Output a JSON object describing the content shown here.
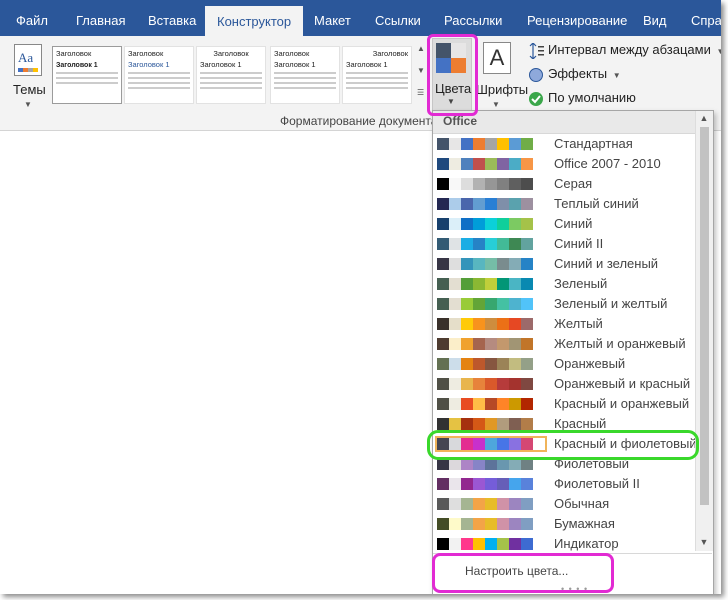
{
  "tabs": [
    {
      "label": "Файл"
    },
    {
      "label": "Главная"
    },
    {
      "label": "Вставка"
    },
    {
      "label": "Конструктор"
    },
    {
      "label": "Макет"
    },
    {
      "label": "Ссылки"
    },
    {
      "label": "Рассылки"
    },
    {
      "label": "Рецензирование"
    },
    {
      "label": "Вид"
    },
    {
      "label": "Справ"
    }
  ],
  "active_tab": "Конструктор",
  "ribbon": {
    "themes_label": "Темы",
    "themes_icon_text": "Aa",
    "gallery": [
      {
        "heading": "Заголовок",
        "title": "Заголовок 1"
      },
      {
        "heading": "Заголовок",
        "title": "Заголовок 1"
      },
      {
        "heading": "Заголовок",
        "title": "Заголовок 1"
      },
      {
        "heading": "Заголовок",
        "title": "Заголовок 1"
      },
      {
        "heading": "Заголовок",
        "title": "Заголовок 1"
      }
    ],
    "colors_label": "Цвета",
    "fonts_label": "Шрифты",
    "fonts_icon_text": "A",
    "paragraph_spacing_label": "Интервал между абзацами",
    "effects_label": "Эффекты",
    "set_default_label": "По умолчанию",
    "group_label": "Форматирование документа"
  },
  "dropdown": {
    "header": "Office",
    "selected": "Красный и фиолетовый",
    "customize_label": "Настроить цвета...",
    "schemes": [
      {
        "name": "Стандартная",
        "colors": [
          "#44546a",
          "#e7e6e6",
          "#4472c4",
          "#ed7d31",
          "#a5a5a5",
          "#ffc000",
          "#5b9bd5",
          "#70ad47"
        ]
      },
      {
        "name": "Office 2007 - 2010",
        "colors": [
          "#1f497d",
          "#eeece1",
          "#4f81bd",
          "#c0504d",
          "#9bbb59",
          "#8064a2",
          "#4bacc6",
          "#f79646"
        ]
      },
      {
        "name": "Серая",
        "colors": [
          "#000000",
          "#f8f8f8",
          "#dddddd",
          "#b2b2b2",
          "#969696",
          "#808080",
          "#5f5f5f",
          "#4d4d4d"
        ]
      },
      {
        "name": "Теплый синий",
        "colors": [
          "#242852",
          "#acccea",
          "#4a66ac",
          "#629dd1",
          "#297fd5",
          "#7f8fa9",
          "#5aa2ae",
          "#9d90a0"
        ]
      },
      {
        "name": "Синий",
        "colors": [
          "#17406d",
          "#dbeff9",
          "#0f6fc6",
          "#009dd9",
          "#0bd0d9",
          "#10cf9b",
          "#7cca62",
          "#a5c249"
        ]
      },
      {
        "name": "Синий II",
        "colors": [
          "#335b74",
          "#dfe3e5",
          "#1cade4",
          "#2683c6",
          "#27ced7",
          "#42ba97",
          "#3e8853",
          "#62a39f"
        ]
      },
      {
        "name": "Синий и зеленый",
        "colors": [
          "#373545",
          "#dedede",
          "#3494ba",
          "#58b6c0",
          "#75bda7",
          "#7a8c8e",
          "#84acb6",
          "#2683c6"
        ]
      },
      {
        "name": "Зеленый",
        "colors": [
          "#455f51",
          "#e3ded1",
          "#549e39",
          "#8ab833",
          "#c0cf3a",
          "#029676",
          "#4ab5c4",
          "#0989b1"
        ]
      },
      {
        "name": "Зеленый и желтый",
        "colors": [
          "#455f51",
          "#e3ded1",
          "#99cb38",
          "#63a537",
          "#37a76f",
          "#44c1a3",
          "#4eb3cf",
          "#51c3f9"
        ]
      },
      {
        "name": "Желтый",
        "colors": [
          "#39302a",
          "#e5dec9",
          "#ffca08",
          "#f8931d",
          "#ce8d3e",
          "#ec7016",
          "#e64823",
          "#9c6a6a"
        ]
      },
      {
        "name": "Желтый и оранжевый",
        "colors": [
          "#4e3b30",
          "#fbeec9",
          "#f0a22e",
          "#a5644e",
          "#b58b80",
          "#c3986d",
          "#a19574",
          "#c17529"
        ]
      },
      {
        "name": "Оранжевый",
        "colors": [
          "#637052",
          "#ccddea",
          "#e48312",
          "#bd582c",
          "#865640",
          "#9b8357",
          "#c2bc80",
          "#94a088"
        ]
      },
      {
        "name": "Оранжевый и красный",
        "colors": [
          "#505046",
          "#eeece1",
          "#e8b54d",
          "#e7833b",
          "#d9592b",
          "#b63b3b",
          "#a4332e",
          "#7f4841"
        ]
      },
      {
        "name": "Красный и оранжевый",
        "colors": [
          "#505046",
          "#eeece1",
          "#e84c22",
          "#ffbd47",
          "#b64926",
          "#ff8427",
          "#cc9900",
          "#b22600"
        ]
      },
      {
        "name": "Красный",
        "colors": [
          "#323232",
          "#e5c243",
          "#a5300f",
          "#d55816",
          "#e19825",
          "#b19c7d",
          "#7f5f52",
          "#b27d49"
        ]
      },
      {
        "name": "Красный и фиолетовый",
        "colors": [
          "#454551",
          "#d8d9dc",
          "#e32d91",
          "#c830cc",
          "#4ea6dc",
          "#4775e7",
          "#8971e1",
          "#d54773"
        ]
      },
      {
        "name": "Фиолетовый",
        "colors": [
          "#373545",
          "#dcd8dc",
          "#ad84c6",
          "#8784c7",
          "#5d739a",
          "#6997af",
          "#84acb6",
          "#6f8183"
        ]
      },
      {
        "name": "Фиолетовый II",
        "colors": [
          "#632e62",
          "#eae5eb",
          "#92278f",
          "#9b57d3",
          "#755dd9",
          "#665eb8",
          "#45a5ed",
          "#5982db"
        ]
      },
      {
        "name": "Обычная",
        "colors": [
          "#595959",
          "#dedede",
          "#a5b592",
          "#f3a447",
          "#e7bc29",
          "#d092a7",
          "#9c85c0",
          "#809ec2"
        ]
      },
      {
        "name": "Бумажная",
        "colors": [
          "#444d26",
          "#fefac9",
          "#a5b592",
          "#f3a447",
          "#e7bc29",
          "#d092a7",
          "#9c85c0",
          "#809ec2"
        ]
      },
      {
        "name": "Индикатор",
        "colors": [
          "#000000",
          "#f2f2f2",
          "#ff388c",
          "#ffc000",
          "#00b0f0",
          "#a5c249",
          "#7030a0",
          "#3d6bd1"
        ]
      }
    ]
  },
  "colors": {
    "tab_bar_bg": "#2b579a",
    "ribbon_bg": "#f3f3f3",
    "annotation_magenta": "#e22ad3",
    "annotation_green": "#39d82b",
    "colors_icon": [
      "#44546a",
      "#e7e6e6",
      "#4472c4",
      "#ed7d31"
    ]
  }
}
